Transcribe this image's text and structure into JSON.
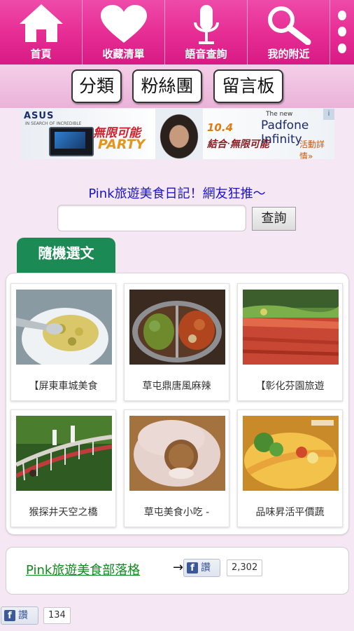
{
  "nav": {
    "items": [
      {
        "label": "首頁",
        "icon": "home-icon"
      },
      {
        "label": "收藏清單",
        "icon": "heart-icon"
      },
      {
        "label": "語音查詢",
        "icon": "microphone-icon"
      },
      {
        "label": "我的附近",
        "icon": "search-icon"
      }
    ],
    "more_icon": "more-vertical-icon"
  },
  "tabs": [
    "分類",
    "粉絲團",
    "留言板"
  ],
  "ad": {
    "brand": "ASUS",
    "brand_sub": "IN SEARCH OF INCREDIBLE",
    "headline": "無限可能",
    "party": "PARTY",
    "date": "10.4",
    "tagline": "結合‧無限可能",
    "the_new": "The new",
    "product": "Padfone Infinity",
    "cta": "活動詳情»"
  },
  "tagline": "Pink旅遊美食日記！網友狂推～",
  "search": {
    "placeholder": "",
    "button_label": "查詢"
  },
  "random_tab": "隨機選文",
  "cards": [
    {
      "caption": "【屏東車城美食"
    },
    {
      "caption": "草屯鼎唐風麻辣"
    },
    {
      "caption": "【彰化芬園旅遊"
    },
    {
      "caption": "猴探井天空之橋"
    },
    {
      "caption": "草屯美食小吃 -"
    },
    {
      "caption": "品味昇活平價蔬"
    }
  ],
  "footer": {
    "blog_link": "Pink旅遊美食部落格",
    "arrow": "→",
    "like_label": "讚",
    "like_count": "2,302"
  },
  "bottom_like": {
    "label": "讚",
    "count": "134"
  },
  "colors": {
    "nav_pink": "#e72e95",
    "tab_green": "#1c8a55",
    "link_green": "#118a1e",
    "tagline_blue": "#1a14c9"
  }
}
